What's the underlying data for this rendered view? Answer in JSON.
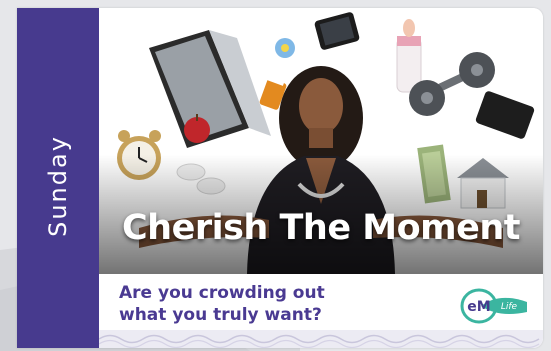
{
  "day": "Sunday",
  "headline": "Cherish The Moment",
  "question": "Are you crowding out what you truly want?",
  "logo": {
    "mark": "eM",
    "tagline": "Life"
  },
  "colors": {
    "brand_purple": "#473a8e",
    "text_purple": "#4a3a92",
    "logo_teal": "#3bb5a0"
  }
}
